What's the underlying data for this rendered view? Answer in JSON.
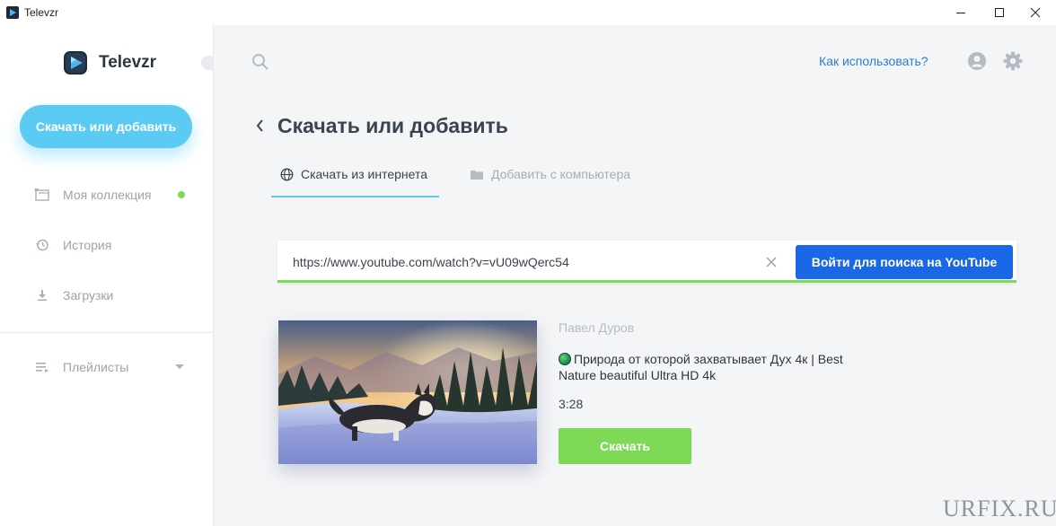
{
  "window": {
    "title": "Televzr"
  },
  "sidebar": {
    "logo_text": "Televzr",
    "primary_button": "Скачать или добавить",
    "items": [
      {
        "label": "Моя коллекция",
        "icon": "collection-icon",
        "has_dot": true
      },
      {
        "label": "История",
        "icon": "history-icon"
      },
      {
        "label": "Загрузки",
        "icon": "download-icon"
      },
      {
        "label": "Плейлисты",
        "icon": "playlist-icon",
        "expandable": true
      }
    ]
  },
  "topbar": {
    "help_link": "Как использовать?"
  },
  "main": {
    "title": "Скачать или добавить",
    "tabs": [
      {
        "label": "Скачать из интернета",
        "icon": "globe-icon",
        "active": true
      },
      {
        "label": "Добавить с компьютера",
        "icon": "folder-icon",
        "active": false
      }
    ],
    "url_input": {
      "value": "https://www.youtube.com/watch?v=vU09wQerc54"
    },
    "search_button": "Войти для поиска на YouTube",
    "video": {
      "author": "Павел Дуров",
      "title": "Природа от которой захватывает Дух 4к | Best Nature beautiful Ultra HD 4k",
      "duration": "3:28",
      "download_button": "Скачать"
    }
  },
  "watermark": "URFIX.RU",
  "colors": {
    "accent": "#5ccbf3",
    "youtube_button": "#1a68e8",
    "success": "#7ed957",
    "link": "#2c7bd6"
  }
}
